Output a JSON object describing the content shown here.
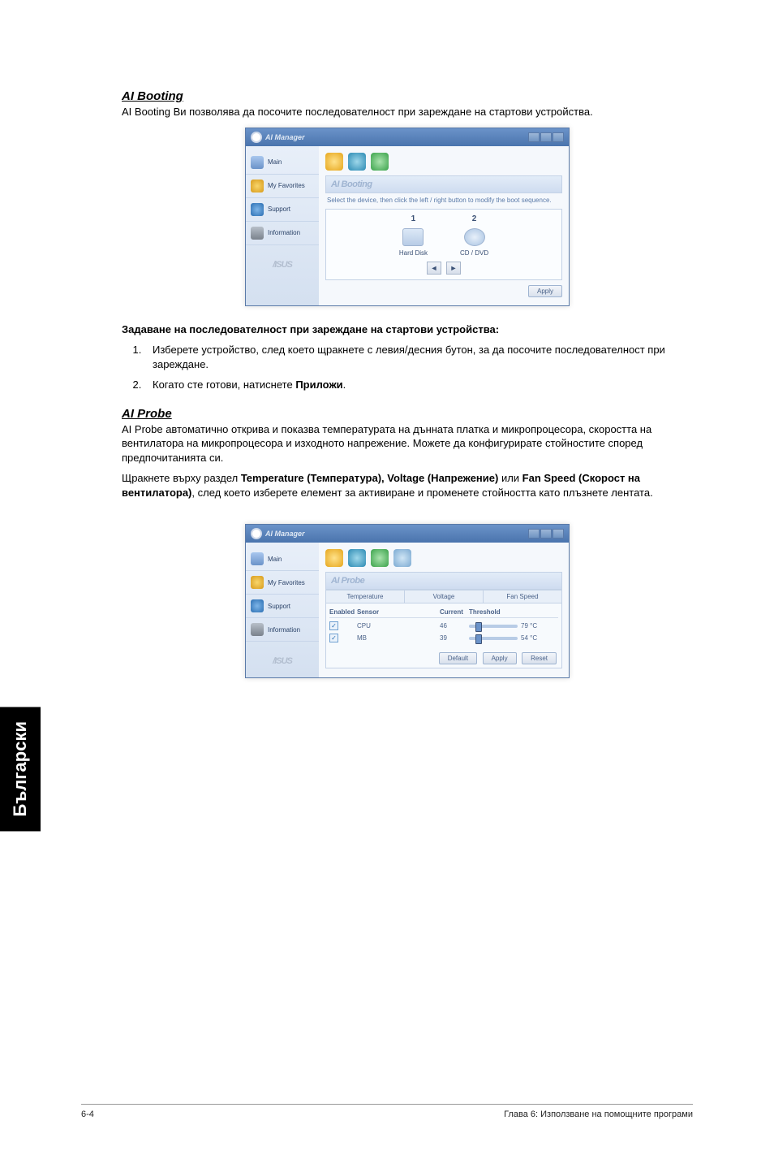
{
  "side_tab": "Български",
  "s1": {
    "title": "AI Booting",
    "desc": "AI Booting Ви позволява да посочите последователност при зареждане на стартови устройства.",
    "setting_header": "Задаване на последователност при зареждане на стартови устройства:",
    "steps": {
      "1": "Изберете устройство, след което щракнете с левия/десния бутон, за да посочите последователност при зареждане.",
      "2_pre": "Когато сте готови, натиснете ",
      "2_bold": "Приложи",
      "2_post": "."
    }
  },
  "s2": {
    "title": "AI Probe",
    "desc": "AI Probe автоматично открива и показва температурата на дънната платка и микропроцесора, скоростта на вентилатора на микропроцесора и изходното напрежение. Можете да конфигурирате стойностите според предпочитанията си.",
    "instr_pre": "Щракнете върху раздел ",
    "instr_b1": "Temperature (Температура), Voltage (Напрежение)",
    "instr_mid": " или ",
    "instr_b2": "Fan Speed (Скорост на вентилатора)",
    "instr_post": ", след което изберете елемент за активиране и променете стойността като плъзнете лентата."
  },
  "mock": {
    "app_title": "AI Manager",
    "brand": "/ISUS",
    "sidebar": {
      "main": "Main",
      "fav": "My Favorites",
      "support": "Support",
      "info": "Information"
    },
    "booting": {
      "panel_title": "AI Booting",
      "panel_desc": "Select the device, then click the left / right button to modify the boot sequence.",
      "col1_num": "1",
      "col2_num": "2",
      "dev1": "Hard Disk",
      "dev2": "CD / DVD",
      "apply": "Apply"
    },
    "probe": {
      "panel_title": "AI Probe",
      "tabs": {
        "temp": "Temperature",
        "volt": "Voltage",
        "fan": "Fan Speed"
      },
      "cols": {
        "enabled": "Enabled",
        "sensor": "Sensor",
        "current": "Current",
        "threshold": "Threshold"
      },
      "rows": [
        {
          "sensor": "CPU",
          "current": "46",
          "threshold": "79 °C"
        },
        {
          "sensor": "MB",
          "current": "39",
          "threshold": "54 °C"
        }
      ],
      "btn_default": "Default",
      "btn_apply": "Apply",
      "btn_reset": "Reset"
    }
  },
  "footer": {
    "left": "6-4",
    "right": "Глава 6: Използване на помощните програми"
  }
}
